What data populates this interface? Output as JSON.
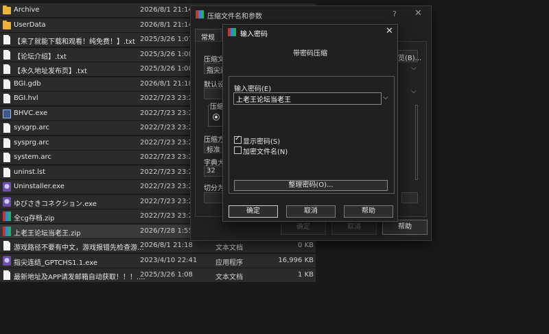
{
  "files": [
    {
      "icon": "folder-icon",
      "name": "Archive",
      "date": "2026/8/1 21:14",
      "type": "",
      "size": ""
    },
    {
      "icon": "folder-icon",
      "name": "UserData",
      "date": "2026/8/1 21:14",
      "type": "",
      "size": ""
    },
    {
      "icon": "doc-icon",
      "name": "【来了就能下载和观看！纯免费！】.txt",
      "date": "2025/3/26 1:07",
      "type": "",
      "size": ""
    },
    {
      "icon": "doc-icon",
      "name": "【论坛介绍】.txt",
      "date": "2025/3/26 1:08",
      "type": "",
      "size": ""
    },
    {
      "icon": "doc-icon",
      "name": "【永久地址发布页】.txt",
      "date": "2025/3/26 1:08",
      "type": "",
      "size": ""
    },
    {
      "icon": "doc-icon",
      "name": "BGI.gdb",
      "date": "2026/8/1 21:18",
      "type": "",
      "size": ""
    },
    {
      "icon": "doc-icon",
      "name": "BGI.hvl",
      "date": "2022/7/23 23:22",
      "type": "",
      "size": ""
    },
    {
      "icon": "exe-icon",
      "name": "BHVC.exe",
      "date": "2022/7/23 23:22",
      "type": "",
      "size": ""
    },
    {
      "icon": "doc-icon",
      "name": "sysgrp.arc",
      "date": "2022/7/23 23:22",
      "type": "",
      "size": ""
    },
    {
      "icon": "doc-icon",
      "name": "sysprg.arc",
      "date": "2022/7/23 23:22",
      "type": "",
      "size": ""
    },
    {
      "icon": "doc-icon",
      "name": "system.arc",
      "date": "2022/7/23 23:22",
      "type": "",
      "size": ""
    },
    {
      "icon": "doc-icon",
      "name": "uninst.lst",
      "date": "2022/7/23 23:22",
      "type": "",
      "size": ""
    },
    {
      "icon": "ghost-icon",
      "name": "Uninstaller.exe",
      "date": "2022/7/23 23:22",
      "type": "",
      "size": ""
    },
    {
      "icon": "ghost-icon",
      "name": "ゆびさきコネクション.exe",
      "date": "2022/7/23 23:22",
      "type": "",
      "size": ""
    },
    {
      "icon": "zip-icon",
      "name": "全cg存档.zip",
      "date": "2022/7/23 23:22",
      "type": "",
      "size": ""
    },
    {
      "icon": "zip-icon",
      "name": "上老王论坛当老王.zip",
      "date": "2026/7/28 1:55",
      "type": "",
      "size": "",
      "selected": true
    },
    {
      "icon": "doc-icon",
      "name": "游戏路径不要有中文，游戏报错先检查游...",
      "date": "2026/8/1 21:18",
      "type": "文本文档",
      "size": "0 KB"
    },
    {
      "icon": "ghost-icon",
      "name": "指尖连结_GPTCHS1.1.exe",
      "date": "2023/4/10 22:41",
      "type": "应用程序",
      "size": "16,996 KB"
    },
    {
      "icon": "doc-icon",
      "name": "最新地址及APP请发邮箱自动获取！！！....",
      "date": "2025/3/26 1:08",
      "type": "文本文档",
      "size": "1 KB"
    }
  ],
  "back_dialog": {
    "title": "压缩文件名和参数",
    "help_glyph": "?",
    "close_glyph": "✕",
    "tab_general": "常规",
    "label_archive_name": "压缩文",
    "archive_name_value": "指尖连",
    "label_default": "默认设",
    "label_format": "压缩文",
    "label_method": "压缩方",
    "method_value": "标准",
    "label_dict": "字典大",
    "dict_value": "32",
    "label_split": "切分为",
    "browse_label": "览(B)...",
    "ok_label": "确定",
    "cancel_label": "取消",
    "help_label": "帮助"
  },
  "pwd_dialog": {
    "title": "输入密码",
    "close_glyph": "✕",
    "heading": "带密码压缩",
    "label_password": "输入密码(E)",
    "password_value": "上老王论坛当老王",
    "show_password_label": "显示密码(S)",
    "show_password_checked": true,
    "encrypt_names_label": "加密文件名(N)",
    "encrypt_names_checked": false,
    "organize_label": "整理密码(O)...",
    "ok_label": "确定",
    "cancel_label": "取消",
    "help_label": "帮助"
  }
}
